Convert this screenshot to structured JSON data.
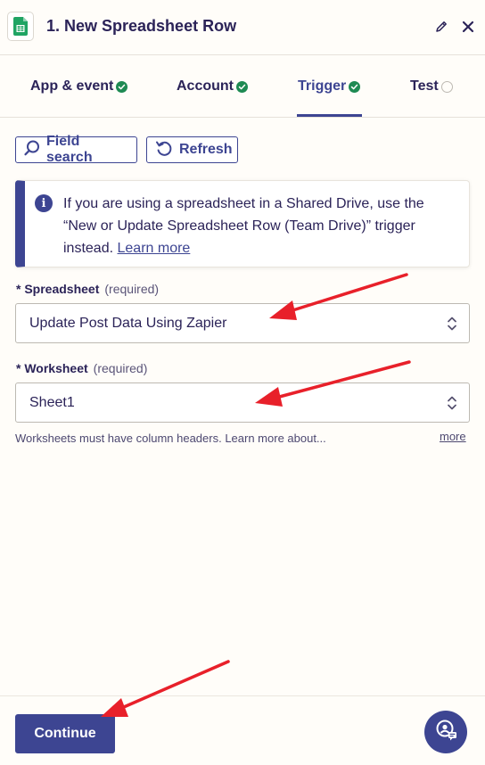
{
  "header": {
    "step_title": "1. New Spreadsheet Row",
    "app_icon": "google-sheets-icon"
  },
  "tabs": [
    {
      "label": "App & event",
      "status": "complete"
    },
    {
      "label": "Account",
      "status": "complete"
    },
    {
      "label": "Trigger",
      "status": "complete",
      "active": true
    },
    {
      "label": "Test",
      "status": "pending"
    }
  ],
  "actions": {
    "field_search_label": "Field search",
    "refresh_label": "Refresh"
  },
  "info": {
    "text": "If you are using a spreadsheet in a Shared Drive, use the “New or Update Spreadsheet Row (Team Drive)” trigger instead.",
    "link_label": "Learn more"
  },
  "fields": {
    "spreadsheet": {
      "label": "Spreadsheet",
      "required_label": "(required)",
      "value": "Update Post Data Using Zapier"
    },
    "worksheet": {
      "label": "Worksheet",
      "required_label": "(required)",
      "value": "Sheet1",
      "helper": "Worksheets must have column headers. Learn more about...",
      "more_label": "more"
    }
  },
  "footer": {
    "continue_label": "Continue"
  },
  "colors": {
    "brand": "#3d4592",
    "success": "#1e8a53",
    "annotation_arrow": "#e8202a",
    "sheets_green": "#1fa463"
  }
}
